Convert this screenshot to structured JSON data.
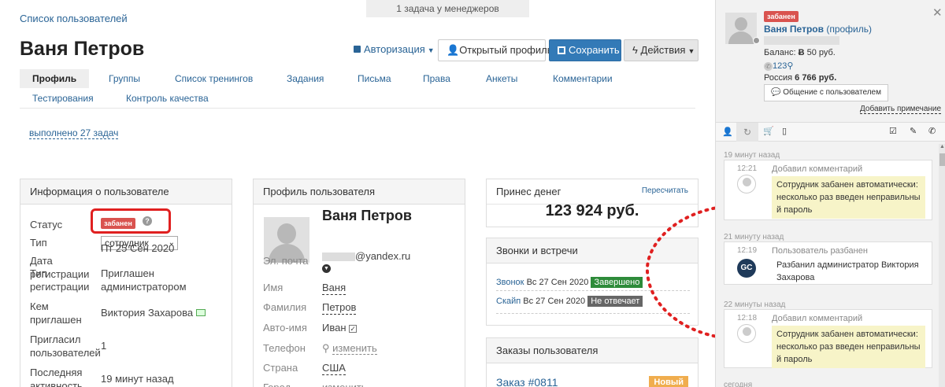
{
  "breadcrumb": "Список пользователей",
  "notice": "1 задача у менеджеров",
  "page_title": "Ваня Петров",
  "header": {
    "auth_label": "Авторизация",
    "open_profile_label": "Открытый профиль",
    "save_label": "Сохранить",
    "actions_label": "Действия"
  },
  "tabs": {
    "row1": [
      "Профиль",
      "Группы",
      "Список тренингов",
      "Задания",
      "Письма",
      "Права",
      "Анкеты",
      "Комментарии"
    ],
    "row2": [
      "Тестирования",
      "Контроль качества"
    ]
  },
  "tasks_done": "выполнено 27 задач",
  "user_info": {
    "title": "Информация о пользователе",
    "status_label": "Статус",
    "status_value": "забанен",
    "type_label": "Тип",
    "type_value": "сотрудник",
    "reg_date_label_1": "Дата",
    "reg_date_label_2": "регистрации",
    "reg_date_value": "Пт 25 Сен 2020",
    "reg_type_label_1": "Тип",
    "reg_type_label_2": "регистрации",
    "reg_type_value_1": "Приглашен",
    "reg_type_value_2": "администратором",
    "invited_by_label_1": "Кем",
    "invited_by_label_2": "приглашен",
    "invited_by_value": "Виктория Захарова",
    "invited_users_label_1": "Пригласил",
    "invited_users_label_2": "пользователей",
    "invited_users_value": "1",
    "last_activity_label_1": "Последняя",
    "last_activity_label_2": "активность",
    "last_activity_value": "19 минут назад"
  },
  "profile": {
    "title": "Профиль пользователя",
    "name": "Ваня Петров",
    "email_label": "Эл. почта",
    "email_value": "@yandex.ru",
    "first_name_label": "Имя",
    "first_name_value": "Ваня",
    "last_name_label": "Фамилия",
    "last_name_value": "Петров",
    "autoname_label": "Авто-имя",
    "autoname_value": "Иван",
    "phone_label": "Телефон",
    "phone_value": "изменить",
    "country_label": "Страна",
    "country_value": "США",
    "city_label": "Город",
    "city_value": "изменить"
  },
  "money": {
    "title": "Принес денег",
    "recalc": "Пересчитать",
    "amount": "123 924 руб."
  },
  "calls": {
    "title": "Звонки и встречи",
    "items": [
      {
        "type": "Звонок",
        "date": "Вс 27 Сен 2020",
        "status": "Завершено"
      },
      {
        "type": "Скайп",
        "date": "Вс 27 Сен 2020",
        "status": "Не отвечает"
      }
    ]
  },
  "orders": {
    "title": "Заказы пользователя",
    "order": "Заказ #0811",
    "badge": "Новый"
  },
  "sidebar": {
    "badge": "забанен",
    "name": "Ваня Петров",
    "profile_link": "(профиль)",
    "balance_label": "Баланс:",
    "balance_value": "50 руб.",
    "phone_short": "123",
    "country": "Россия",
    "country_sum": "6 766 руб.",
    "chat_button": "Общение с пользователем",
    "add_note": "Добавить примечание",
    "feed": [
      {
        "ago": "19 минут назад",
        "time": "12:21",
        "title": "Добавил комментарий",
        "msg": [
          "Сотрудник забанен автоматически:",
          "несколько раз введен неправильны",
          "й пароль"
        ],
        "highlight": true,
        "avatar": ""
      },
      {
        "ago": "21 минуту назад",
        "time": "12:19",
        "title": "Пользователь разбанен",
        "msg": [
          "Разбанил администратор Виктория",
          "Захарова"
        ],
        "highlight": false,
        "avatar": "GC"
      },
      {
        "ago": "22 минуты назад",
        "time": "12:18",
        "title": "Добавил комментарий",
        "msg": [
          "Сотрудник забанен автоматически:",
          "несколько раз введен неправильны",
          "й пароль"
        ],
        "highlight": true,
        "avatar": ""
      }
    ],
    "feed_more": "сегодня"
  },
  "colors": {
    "accent": "#2a6496",
    "primary_button": "#337ab7",
    "ban_red": "#d9534f",
    "annotation_red": "#e02020",
    "status_green": "#2e8b3a",
    "order_orange": "#f0ad4e"
  }
}
